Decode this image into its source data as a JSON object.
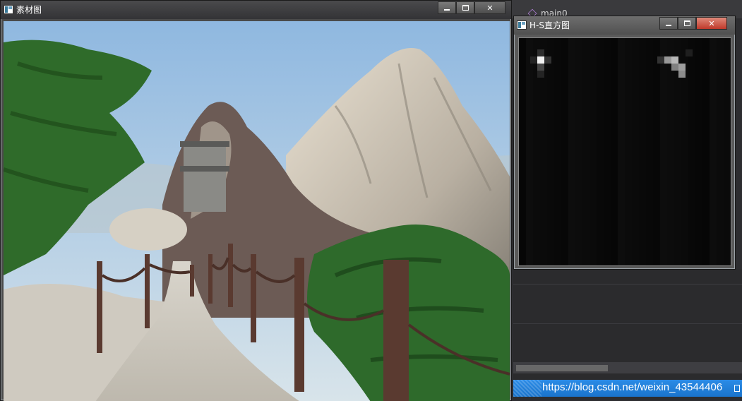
{
  "ide": {
    "code_label": "main0",
    "watermark": "https://blog.csdn.net/weixin_43544406",
    "accent_color": "#1e88e5"
  },
  "windows": {
    "photo": {
      "title": "素材图",
      "buttons": {
        "minimize": "minimize",
        "maximize": "maximize",
        "close": "close"
      }
    },
    "histogram": {
      "title": "H-S直方图",
      "buttons": {
        "minimize": "minimize",
        "maximize": "maximize",
        "close": "close"
      },
      "bright_cells": [
        {
          "col": 1,
          "row": 1,
          "v": 0.95
        },
        {
          "col": 1,
          "row": 0,
          "v": 0.18
        },
        {
          "col": 0,
          "row": 1,
          "v": 0.14
        },
        {
          "col": 2,
          "row": 1,
          "v": 0.2
        },
        {
          "col": 1,
          "row": 2,
          "v": 0.28
        },
        {
          "col": 1,
          "row": 3,
          "v": 0.14
        },
        {
          "col": 19,
          "row": 1,
          "v": 0.6
        },
        {
          "col": 20,
          "row": 1,
          "v": 0.72
        },
        {
          "col": 20,
          "row": 2,
          "v": 0.5
        },
        {
          "col": 21,
          "row": 2,
          "v": 0.62
        },
        {
          "col": 21,
          "row": 3,
          "v": 0.55
        },
        {
          "col": 18,
          "row": 1,
          "v": 0.2
        },
        {
          "col": 22,
          "row": 0,
          "v": 0.12
        }
      ]
    }
  }
}
